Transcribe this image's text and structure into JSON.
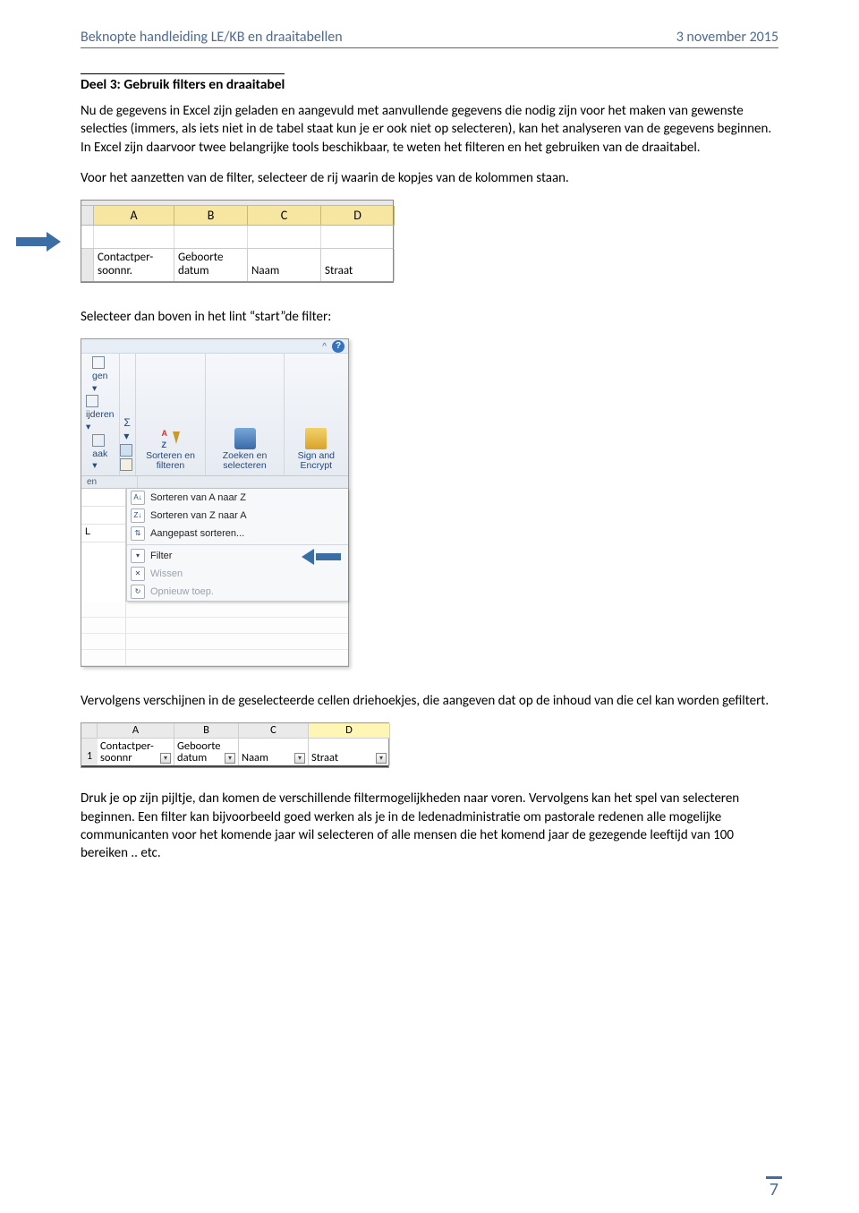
{
  "header": {
    "title_left": "Beknopte handleiding LE/KB en draaitabellen",
    "title_right": "3 november 2015"
  },
  "section": {
    "heading": "Deel 3: Gebruik filters en draaitabel",
    "p1": "Nu de gegevens in Excel zijn geladen en aangevuld met aanvullende gegevens die nodig zijn voor het maken van gewenste selecties (immers, als iets niet in de tabel staat kun je er ook niet op selecteren), kan het analyseren van de gegevens beginnen. In Excel zijn daarvoor twee belangrijke tools beschikbaar, te weten het filteren en het gebruiken van de draaitabel.",
    "p2": "Voor het aanzetten van de filter, selecteer de rij waarin de kopjes van de kolommen staan.",
    "p3": "Selecteer dan boven in het lint “start”de filter:",
    "p4": "Vervolgens verschijnen in de geselecteerde cellen driehoekjes, die aangeven dat op de inhoud van die cel kan worden gefiltert.",
    "p5": "Druk je op zijn pijltje, dan komen de verschillende filtermogelijkheden naar voren. Vervolgens kan het spel van selecteren beginnen.  Een filter kan bijvoorbeeld goed werken als je in de ledenadministratie om pastorale redenen alle mogelijke communicanten voor het komende jaar wil selecteren of alle mensen die het komend jaar de gezegende leeftijd van 100 bereiken .. etc."
  },
  "fig1": {
    "cols": [
      "A",
      "B",
      "C",
      "D"
    ],
    "headers": {
      "a_line1": "Contactper-",
      "a_line2": "soonnr.",
      "b_line1": "Geboorte",
      "b_line2": "datum",
      "c": "Naam",
      "d": "Straat"
    }
  },
  "fig2": {
    "help_glyph": "?",
    "chev_glyph": "^",
    "left_small": {
      "l1": "gen",
      "l2": "ijderen",
      "l3": "aak"
    },
    "sort_btn": "Sorteren en filteren",
    "search_btn": "Zoeken en selecteren",
    "sign_btn": "Sign and Encrypt",
    "ribbon_label": "en",
    "left_cell_L": "L",
    "menu": {
      "az": "Sorteren van A naar Z",
      "za": "Sorteren van Z naar A",
      "custom": "Aangepast sorteren...",
      "filter": "Filter",
      "clear": "Wissen",
      "reapply": "Opnieuw toep."
    }
  },
  "fig3": {
    "cols": [
      "A",
      "B",
      "C",
      "D"
    ],
    "rownum": "1",
    "headers": {
      "a_line1": "Contactper-",
      "a_line2": "soonnr",
      "b_line1": "Geboorte",
      "b_line2": "datum",
      "c": "Naam",
      "d": "Straat"
    },
    "filter_glyph": "▾"
  },
  "page_number": "7"
}
